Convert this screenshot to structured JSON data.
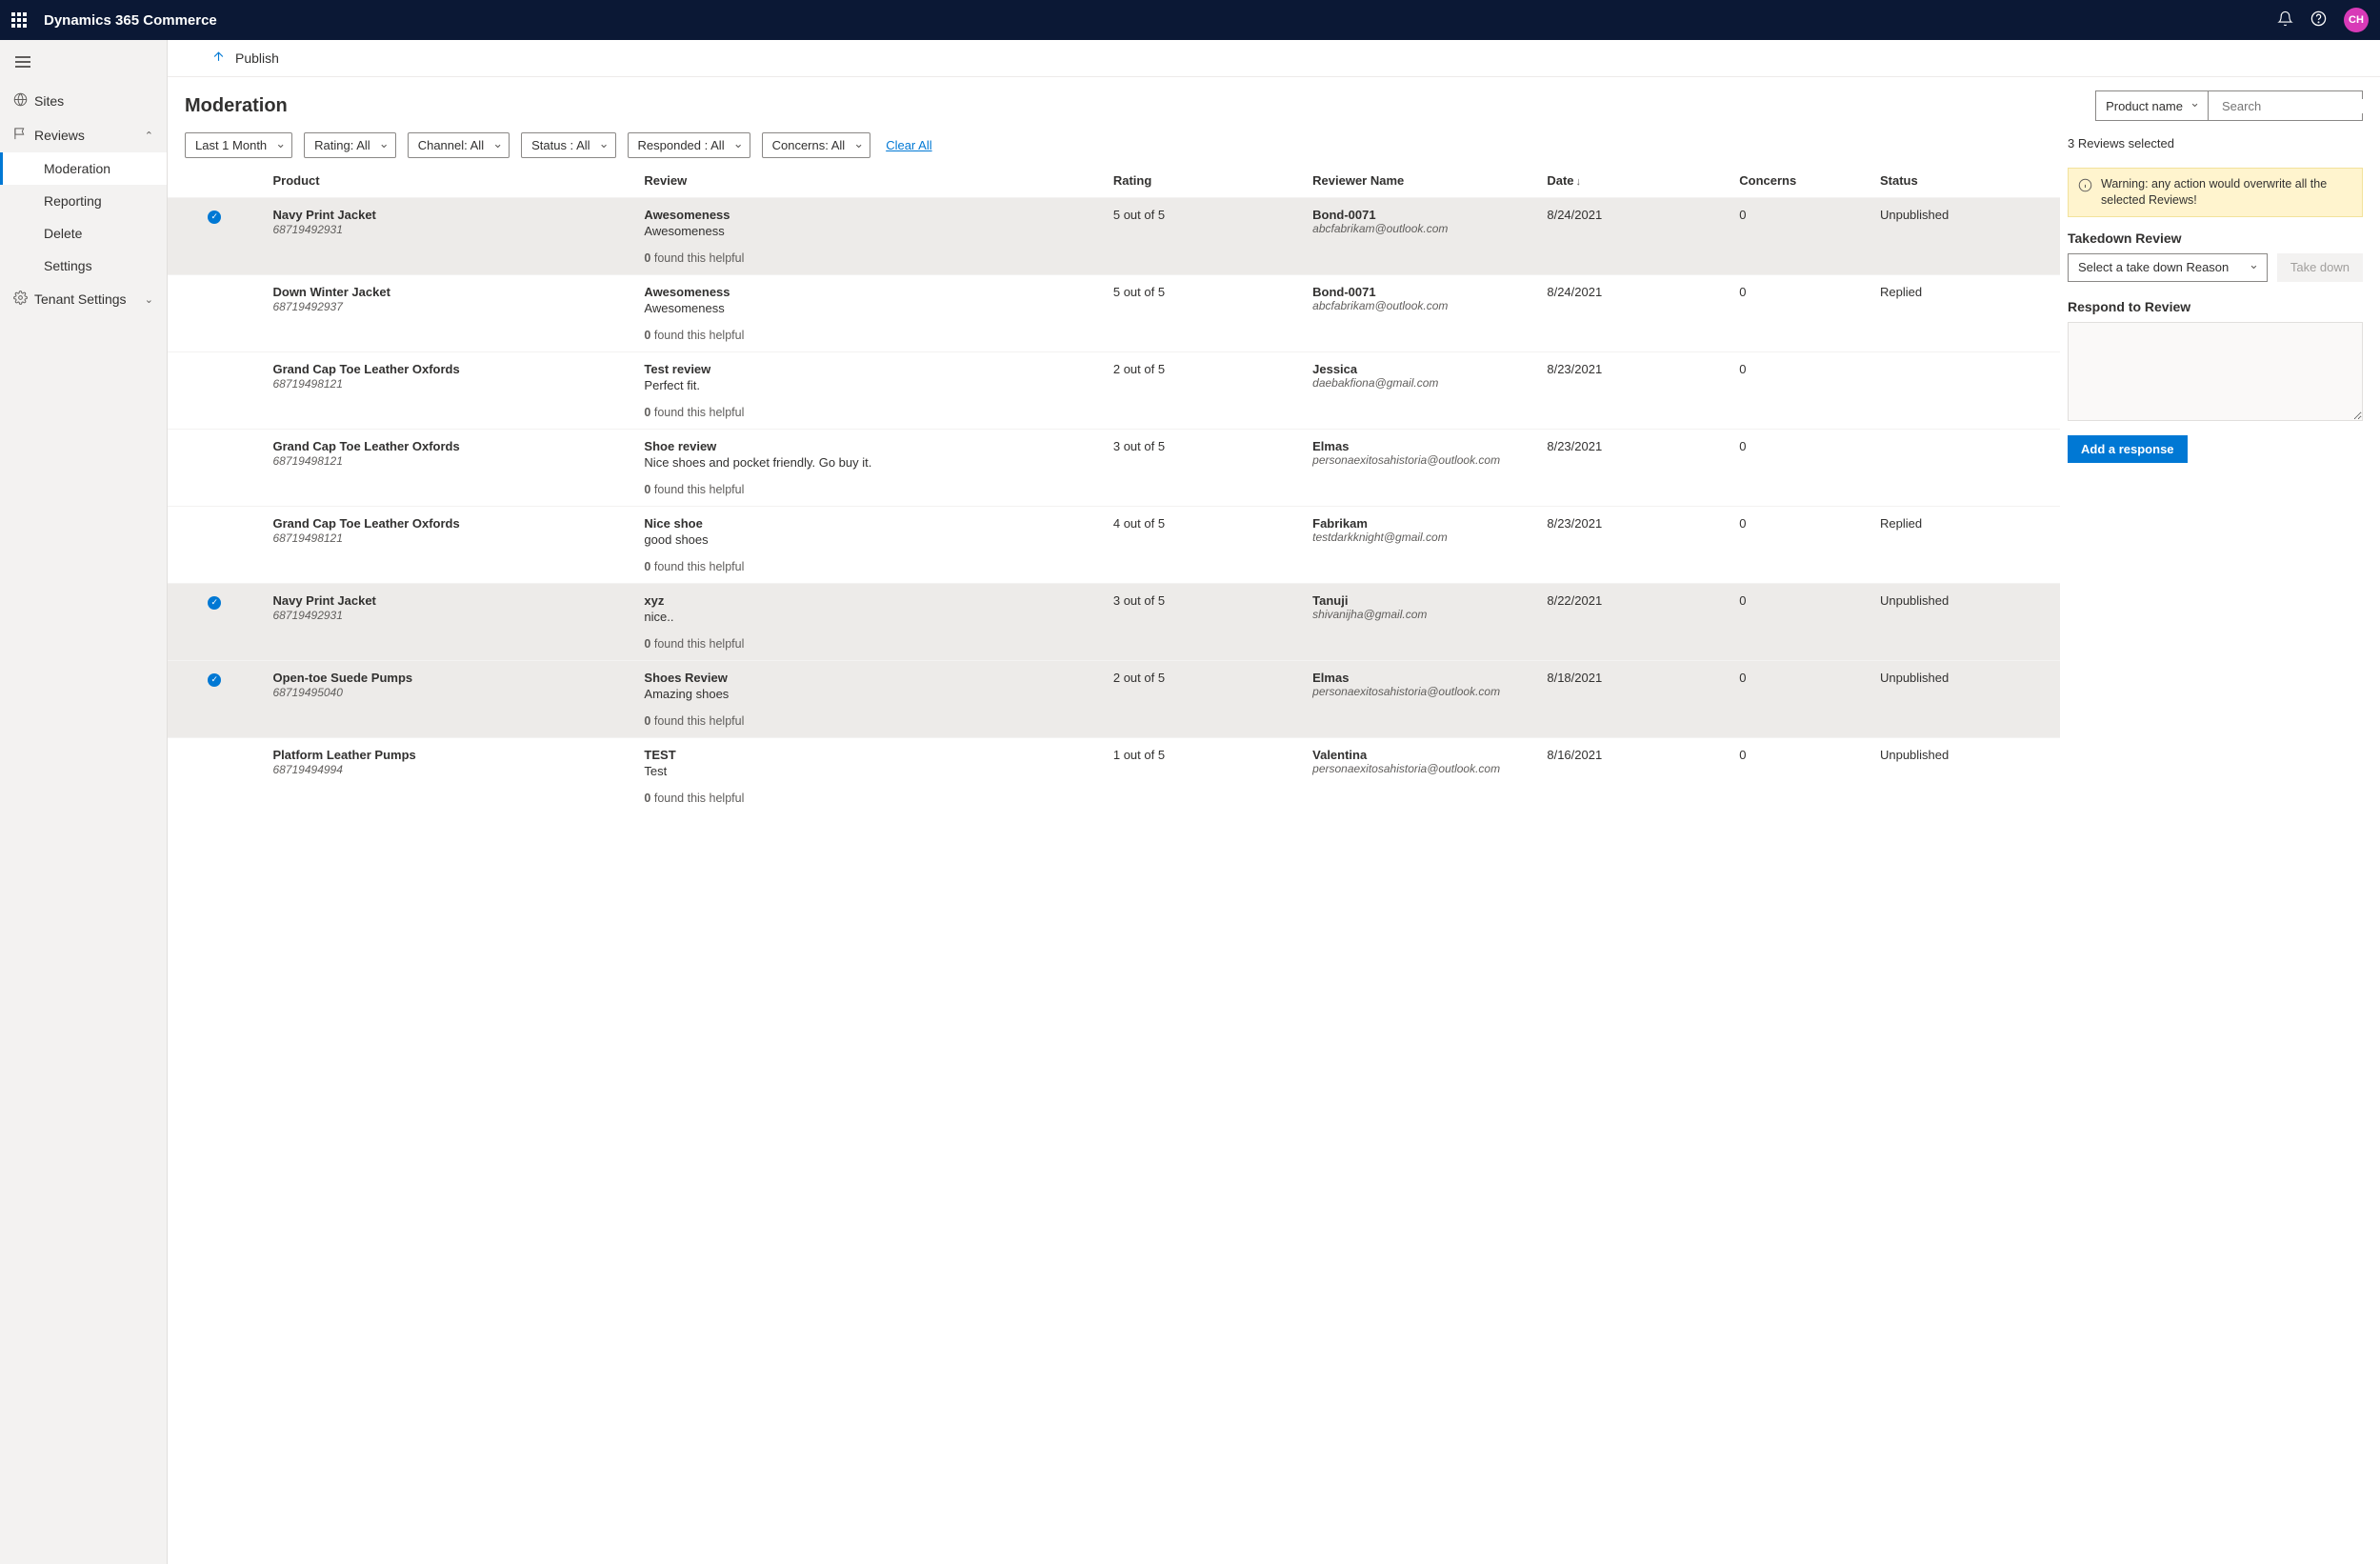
{
  "header": {
    "appTitle": "Dynamics 365 Commerce",
    "avatar": "CH"
  },
  "nav": {
    "sites": "Sites",
    "reviews": "Reviews",
    "moderation": "Moderation",
    "reporting": "Reporting",
    "delete": "Delete",
    "settings": "Settings",
    "tenant": "Tenant Settings"
  },
  "publish": {
    "label": "Publish"
  },
  "page": {
    "title": "Moderation"
  },
  "filters": {
    "range": "Last 1 Month",
    "rating": "Rating: All",
    "channel": "Channel: All",
    "status": "Status : All",
    "responded": "Responded : All",
    "concerns": "Concerns: All",
    "clear": "Clear All"
  },
  "titleControls": {
    "productSelect": "Product name",
    "searchPlaceholder": "Search"
  },
  "columns": {
    "product": "Product",
    "review": "Review",
    "rating": "Rating",
    "reviewer": "Reviewer Name",
    "date": "Date",
    "concerns": "Concerns",
    "status": "Status"
  },
  "helpfulSuffix": "found this helpful",
  "rows": [
    {
      "selected": true,
      "product": "Navy Print Jacket",
      "pid": "68719492931",
      "title": "Awesomeness",
      "body": "Awesomeness",
      "helpful": "0",
      "rating": "5 out of 5",
      "reviewer": "Bond-0071",
      "email": "abcfabrikam@outlook.com",
      "date": "8/24/2021",
      "concerns": "0",
      "status": "Unpublished"
    },
    {
      "selected": false,
      "product": "Down Winter Jacket",
      "pid": "68719492937",
      "title": "Awesomeness",
      "body": "Awesomeness",
      "helpful": "0",
      "rating": "5 out of 5",
      "reviewer": "Bond-0071",
      "email": "abcfabrikam@outlook.com",
      "date": "8/24/2021",
      "concerns": "0",
      "status": "Replied"
    },
    {
      "selected": false,
      "product": "Grand Cap Toe Leather Oxfords",
      "pid": "68719498121",
      "title": "Test review",
      "body": "Perfect fit.",
      "helpful": "0",
      "rating": "2 out of 5",
      "reviewer": "Jessica",
      "email": "daebakfiona@gmail.com",
      "date": "8/23/2021",
      "concerns": "0",
      "status": ""
    },
    {
      "selected": false,
      "product": "Grand Cap Toe Leather Oxfords",
      "pid": "68719498121",
      "title": "Shoe review",
      "body": "Nice shoes and pocket friendly. Go buy it.",
      "helpful": "0",
      "rating": "3 out of 5",
      "reviewer": "Elmas",
      "email": "personaexitosahistoria@outlook.com",
      "date": "8/23/2021",
      "concerns": "0",
      "status": ""
    },
    {
      "selected": false,
      "product": "Grand Cap Toe Leather Oxfords",
      "pid": "68719498121",
      "title": "Nice shoe",
      "body": "good shoes",
      "helpful": "0",
      "rating": "4 out of 5",
      "reviewer": "Fabrikam",
      "email": "testdarkknight@gmail.com",
      "date": "8/23/2021",
      "concerns": "0",
      "status": "Replied"
    },
    {
      "selected": true,
      "product": "Navy Print Jacket",
      "pid": "68719492931",
      "title": "xyz",
      "body": "nice..",
      "helpful": "0",
      "rating": "3 out of 5",
      "reviewer": "Tanuji",
      "email": "shivanijha@gmail.com",
      "date": "8/22/2021",
      "concerns": "0",
      "status": "Unpublished"
    },
    {
      "selected": true,
      "product": "Open-toe Suede Pumps",
      "pid": "68719495040",
      "title": "Shoes Review",
      "body": "Amazing shoes",
      "helpful": "0",
      "rating": "2 out of 5",
      "reviewer": "Elmas",
      "email": "personaexitosahistoria@outlook.com",
      "date": "8/18/2021",
      "concerns": "0",
      "status": "Unpublished"
    },
    {
      "selected": false,
      "product": "Platform Leather Pumps",
      "pid": "68719494994",
      "title": "TEST",
      "body": "Test",
      "helpful": "0",
      "rating": "1 out of 5",
      "reviewer": "Valentina",
      "email": "personaexitosahistoria@outlook.com",
      "date": "8/16/2021",
      "concerns": "0",
      "status": "Unpublished"
    }
  ],
  "side": {
    "count": "3 Reviews selected",
    "warning": "Warning: any action would overwrite all the selected Reviews!",
    "takedownH": "Takedown Review",
    "reasonPlaceholder": "Select a take down Reason",
    "takedownBtn": "Take down",
    "respondH": "Respond to Review",
    "addResponse": "Add a response"
  }
}
